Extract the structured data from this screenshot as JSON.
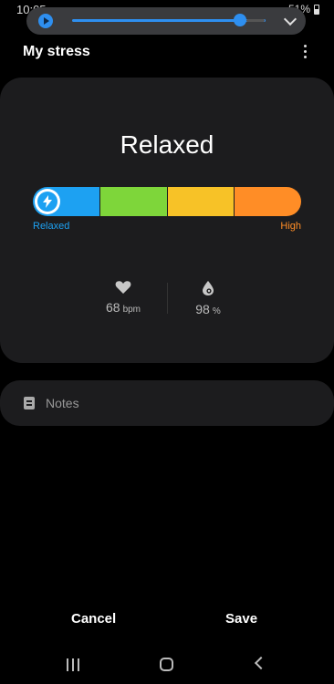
{
  "status_bar": {
    "time": "10:05",
    "battery": "51%"
  },
  "media_overlay": {
    "progress": 0.87
  },
  "header": {
    "title": "My stress"
  },
  "stress": {
    "level_label": "Relaxed",
    "scale_low_label": "Relaxed",
    "scale_high_label": "High",
    "segment_colors": [
      "#1da1f2",
      "#7ed63a",
      "#f7c227",
      "#ff8d26"
    ],
    "low_color": "#1da1f2",
    "high_color": "#ff8d26"
  },
  "metrics": {
    "heart_rate": {
      "value": "68",
      "unit": "bpm",
      "icon": "heart-icon"
    },
    "spo2": {
      "value": "98",
      "unit": "%",
      "icon": "blood-drop-icon"
    }
  },
  "notes": {
    "label": "Notes",
    "icon": "note-icon"
  },
  "actions": {
    "cancel_label": "Cancel",
    "save_label": "Save"
  },
  "nav": {
    "icons": [
      "recent-apps-icon",
      "home-icon",
      "back-icon"
    ]
  }
}
